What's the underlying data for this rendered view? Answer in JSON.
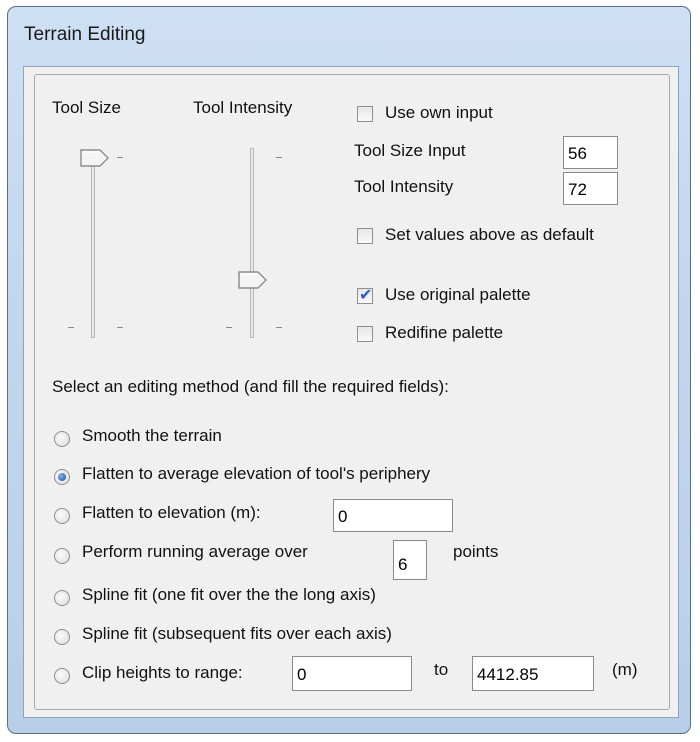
{
  "window": {
    "title": "Terrain Editing"
  },
  "sliders": {
    "tool_size_label": "Tool Size",
    "tool_intensity_label": "Tool Intensity",
    "tool_size_level": 0.0,
    "tool_intensity_level": 0.72
  },
  "own_input": {
    "use_own_input_label": "Use own input",
    "use_own_input_checked": false,
    "tool_size_input_label": "Tool Size Input",
    "tool_size_input_value": "56",
    "tool_intensity_label": "Tool Intensity",
    "tool_intensity_value": "72",
    "set_default_label": "Set values above as default",
    "set_default_checked": false
  },
  "palette": {
    "use_original_label": "Use original palette",
    "use_original_checked": true,
    "redefine_label": "Redifine palette",
    "redefine_checked": false
  },
  "method": {
    "prompt": "Select an editing method (and fill the required fields):",
    "selected": "flatten-average",
    "options": {
      "smooth": "Smooth the terrain",
      "flatten_average": "Flatten to average elevation of tool's periphery",
      "flatten_elevation": "Flatten to elevation (m):",
      "running_average_prefix": "Perform running average over",
      "running_average_suffix": "points",
      "spline_long": "Spline fit (one fit over the the long axis)",
      "spline_each": "Spline fit (subsequent fits over each axis)",
      "clip_prefix": "Clip heights to range:",
      "clip_to": "to",
      "clip_unit": "(m)"
    },
    "fields": {
      "elevation_value": "0",
      "running_points_value": "6",
      "clip_min_value": "0",
      "clip_max_value": "4412.85"
    }
  },
  "colors": {
    "frame": "#c4d8ef",
    "client_bg": "#f0f0f0",
    "accent": "#2c5fbf"
  }
}
